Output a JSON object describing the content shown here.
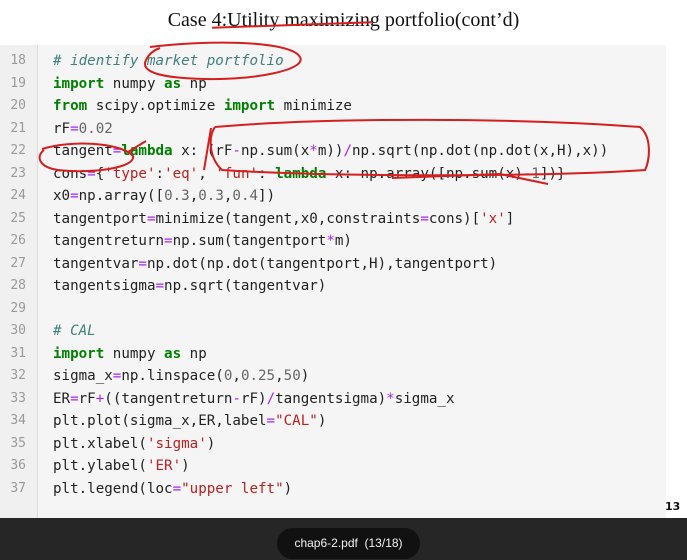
{
  "slide": {
    "title": "Case 4:Utility maximizing portfolio(cont’d)",
    "page_number": "13"
  },
  "code": {
    "lines": [
      {
        "ln": "18",
        "text": "# identify market portfolio"
      },
      {
        "ln": "19",
        "text": "import numpy as np"
      },
      {
        "ln": "20",
        "text": "from scipy.optimize import minimize"
      },
      {
        "ln": "21",
        "text": "rF=0.02"
      },
      {
        "ln": "22",
        "text": "tangent=lambda x: (rF-np.sum(x*m))/np.sqrt(np.dot(np.dot(x,H),x))"
      },
      {
        "ln": "23",
        "text": "cons={'type':'eq', 'fun': lambda x: np.array([np.sum(x)-1])}"
      },
      {
        "ln": "24",
        "text": "x0=np.array([0.3,0.3,0.4])"
      },
      {
        "ln": "25",
        "text": "tangentport=minimize(tangent,x0,constraints=cons)['x']"
      },
      {
        "ln": "26",
        "text": "tangentreturn=np.sum(tangentport*m)"
      },
      {
        "ln": "27",
        "text": "tangentvar=np.dot(np.dot(tangentport,H),tangentport)"
      },
      {
        "ln": "28",
        "text": "tangentsigma=np.sqrt(tangentvar)"
      },
      {
        "ln": "29",
        "text": ""
      },
      {
        "ln": "30",
        "text": "# CAL"
      },
      {
        "ln": "31",
        "text": "import numpy as np"
      },
      {
        "ln": "32",
        "text": "sigma_x=np.linspace(0,0.25,50)"
      },
      {
        "ln": "33",
        "text": "ER=rF+((tangentreturn-rF)/tangentsigma)*sigma_x"
      },
      {
        "ln": "34",
        "text": "plt.plot(sigma_x,ER,label=\"CAL\")"
      },
      {
        "ln": "35",
        "text": "plt.xlabel('sigma')"
      },
      {
        "ln": "36",
        "text": "plt.ylabel('ER')"
      },
      {
        "ln": "37",
        "text": "plt.legend(loc=\"upper left\")"
      }
    ]
  },
  "toolbar": {
    "filename": "chap6-2.pdf",
    "page_indicator": "(13/18)"
  },
  "colors": {
    "annotation_red": "#d51e1e",
    "keyword_green": "#008000",
    "comment_teal": "#408080",
    "string_red": "#ba2121"
  }
}
